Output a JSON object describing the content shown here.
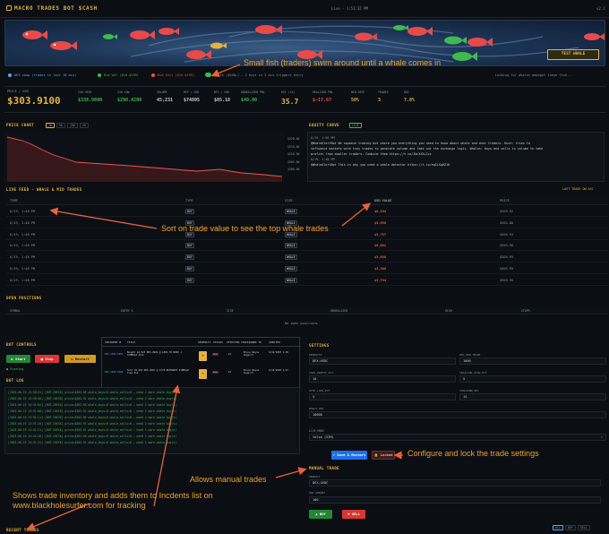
{
  "header": {
    "logo": "MACRO TRADES BOT $CASH",
    "status": "Live · 1:51:32 PM",
    "version": "v2.1"
  },
  "aquarium": {
    "test_whale_label": "TEST WHALE"
  },
  "legend": {
    "items": [
      "DEX swap (trades in last 10 min)",
      "Bid WAT ($10-$199)",
      "Bid Sell ($10-$199)",
      "Whale ($500+) — 2 buys in 2 min triggers entry"
    ],
    "status": "Looking for whales amongst these fish..."
  },
  "stats": {
    "price_label": "PRICE / USD",
    "price": "$303.9100",
    "cells": [
      {
        "label": "24H HIGH",
        "value": "$338.9800",
        "color": "#3fb950"
      },
      {
        "label": "24H LOW",
        "value": "$298.4200",
        "color": "#3fb950"
      },
      {
        "label": "VOLUME",
        "value": "45,231",
        "color": "#c9d1d9"
      },
      {
        "label": "MCP / USD",
        "value": "$74895",
        "color": "#c9d1d9"
      },
      {
        "label": "BTC / USD",
        "value": "$85.18",
        "color": "#c9d1d9"
      },
      {
        "label": "UNREALIZED PNL",
        "value": "$40.00",
        "color": "#3fb950"
      },
      {
        "label": "RSI (14)",
        "value": "35.7",
        "color": "#e3b341"
      },
      {
        "label": "REALIZED PNL",
        "value": "$-17.67",
        "color": "#f85149"
      },
      {
        "label": "WIN RATE",
        "value": "50%",
        "color": "#e3b341"
      },
      {
        "label": "TRADES",
        "value": "3",
        "color": "#e3b341"
      },
      {
        "label": "ROI",
        "value": "7.8%",
        "color": "#e3b341"
      }
    ]
  },
  "price_chart": {
    "title": "PRICE CHART",
    "tabs": [
      "1m",
      "5m",
      "15m",
      "1h"
    ],
    "ticks": [
      "$320.00",
      "$315.00",
      "$310.00",
      "$305.00",
      "$300.00"
    ]
  },
  "equity": {
    "title": "EQUITY CURVE",
    "badge": "LIVE",
    "lines": [
      "6/19, 1:50 PM",
      "@WhaleAlertBot We squeeze trading bot where you everything you need to know about whale and dust traders. Dust: tries to",
      "influence markets with tiny trades to generate volume and fake out the exchange logic. Whales: buys and sells in volume to take",
      "profits from smaller traders. Combine them https://t.co/1bLXXX+1is",
      "6/19, 1:48 PM",
      "@WhaleAlertBot This is why you need a whale detector https://t.co/eqZiSq6210"
    ]
  },
  "feed": {
    "title": "LIVE FEED - WHALE & MID TRADES",
    "right": "LAST TRADE ON ASC",
    "headers": [
      "TIME",
      "TYPE",
      "SIZE",
      "USD VALUE",
      "PRICE"
    ],
    "rows": [
      {
        "time": "6/19, 1:48 PM",
        "type": "BUY",
        "size": "WHALE",
        "value": "$8,204",
        "price": "$303.92"
      },
      {
        "time": "6/19, 1:48 PM",
        "type": "BUY",
        "size": "WHALE",
        "value": "$5,956",
        "price": "$303.88"
      },
      {
        "time": "6/19, 1:48 PM",
        "type": "BUY",
        "size": "WHALE",
        "value": "$5,797",
        "price": "$303.94"
      },
      {
        "time": "6/19, 1:46 PM",
        "type": "BUY",
        "size": "WHALE",
        "value": "$6,001",
        "price": "$303.96"
      },
      {
        "time": "6/19, 1:48 PM",
        "type": "BUY",
        "size": "WHALE",
        "value": "$5,886",
        "price": "$303.95"
      },
      {
        "time": "6/19, 1:48 PM",
        "type": "BUY",
        "size": "WHALE",
        "value": "$5,300",
        "price": "$303.95"
      },
      {
        "time": "6/19, 1:48 PM",
        "type": "BUY",
        "size": "WHALE",
        "value": "$5,794",
        "price": "$303.95"
      }
    ]
  },
  "positions": {
    "title": "OPEN POSITIONS",
    "headers": [
      "SYMBOL",
      "ENTRY $",
      "SIZE",
      "UNREALIZED",
      "HIGH",
      "STOPS"
    ],
    "empty": "No open positions"
  },
  "controls": {
    "title": "BOT CONTROLS",
    "start": "▶ Start",
    "stop": "■ Stop",
    "restart": "↻ Restart",
    "running": "● Running"
  },
  "incidents": {
    "headers": [
      "INCIDENT #",
      "TITLE",
      "SEVERITY",
      "STATUS",
      "AFFECTED CI",
      "ASSIGNED TO",
      "CREATED"
    ],
    "rows": [
      {
        "id": "INC-2025-0491",
        "title": "Bought $4,923 DEX-USDC @ $304.70 NODE 1 SYMBOL# time",
        "sev": "M",
        "status": "Low",
        "ci": "$3",
        "owner": "Bruce Wayne Support",
        "created": "6/19/2025 1:48"
      },
      {
        "id": "INC-2025-0489",
        "title": "Sold $5,093 DEX-USDC @ $776 BUYNODE1 SYMBOL# time Pos",
        "sev": "M",
        "status": "Low",
        "ci": "$3",
        "owner": "Bruce Wayne Support",
        "created": "6/19/2025 1:47"
      }
    ]
  },
  "log": {
    "title": "BOT LOG",
    "lines": [
      "[2025-06-19 13:50:51] [BOT-CHECK] price=$303.88 whale_buys=0 whale_sells=0 — need 2 more whale buy(s)",
      "[2025-06-19 13:50:56] [BOT-CHECK] price=$303.91 whale_buys=0 whale_sells=0 — need 2 more whale buy(s)",
      "[2025-06-19 13:51:01] [BOT-CHECK] price=$303.90 whale_buys=0 whale_sells=0 — need 2 more whale buy(s)",
      "[2025-06-19 13:51:06] [BOT-CHECK] price=$303.92 whale_buys=0 whale_sells=0 — need 2 more whale buy(s)",
      "[2025-06-19 13:51:11] [BOT-CHECK] price=$303.89 whale_buys=0 whale_sells=0 — need 2 more whale buy(s)",
      "[2025-06-19 13:51:16] [BOT-CHECK] price=$303.93 whale_buys=0 whale_sells=0 — need 2 more whale buy(s)",
      "[2025-06-19 13:51:21] [BOT-CHECK] price=$303.91 whale_buys=0 whale_sells=0 — need 2 more whale buy(s)",
      "[2025-06-19 13:51:26] [BOT-CHECK] price=$303.90 whale_buys=0 whale_sells=0 — need 2 more whale buy(s)",
      "[2025-06-19 13:51:31] [BOT-CHECK] price=$303.91 whale_buys=0 whale_sells=0 — need 2 more whale buy(s)"
    ]
  },
  "settings": {
    "title": "SETTINGS",
    "fields": [
      {
        "label": "PRODUCTS",
        "value": "DEX-USDC"
      },
      {
        "label": "USD_PER_TRADE",
        "value": "1000"
      },
      {
        "label": "TAKE_PROFIT_PCT",
        "value": "10"
      },
      {
        "label": "TRAILING_STOP_PCT",
        "value": "5"
      },
      {
        "label": "STOP_LOSS_PCT",
        "value": "5"
      },
      {
        "label": "COOLDOWN_SEC",
        "value": "15"
      },
      {
        "label": "WHALE_USD",
        "value": "10000"
      }
    ],
    "live_label": "LIVE_MODE",
    "live_value": "false (SIM)",
    "save": "✔ Save & Restart",
    "locked": "🔒 Locked"
  },
  "manual": {
    "title": "MANUAL TRADE",
    "product_label": "PRODUCT",
    "product": "DEX-USDC",
    "amount_label": "USD AMOUNT",
    "amount": "100",
    "buy": "▲ BUY",
    "sell": "▼ SELL"
  },
  "recent": {
    "title": "RECENT TRADES",
    "tabs": [
      "ALL",
      "BUY",
      "SELL"
    ]
  },
  "annotations": {
    "fish": "Small fish (traders) swim around until a whale comes in",
    "sort": "Sort on trade value to see the top whale trades",
    "config": "Configure and lock the trade settings",
    "manual": "Allows manual trades",
    "inventory": "Shows trade inventory and adds them to Incdents list on www.blackholesurfer.com for tracking"
  }
}
